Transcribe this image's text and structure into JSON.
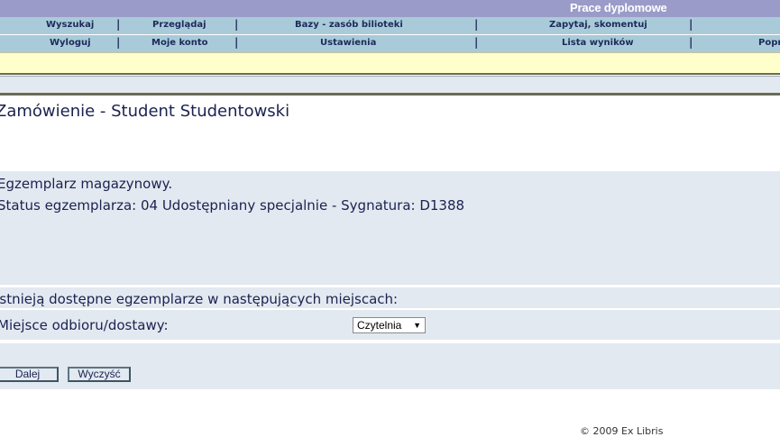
{
  "header": {
    "title": "Prace dyplomowe"
  },
  "nav": {
    "row1": [
      "Wyszukaj",
      "Przeglądaj",
      "Bazy - zasób bilioteki",
      "Zapytaj, skomentuj"
    ],
    "row2": [
      "Wyloguj",
      "Moje konto",
      "Ustawienia",
      "Lista wyników",
      "Popr"
    ],
    "separator": "|"
  },
  "page": {
    "title": "Zamówienie - Student Studentowski",
    "item_type": "Egzemplarz magazynowy.",
    "item_status": "Status egzemplarza: 04 Udostępniany specjalnie - Sygnatura: D1388",
    "availability_note": "Istnieją dostępne egzemplarze w następujących miejscach:",
    "pickup_label": "Miejsce odbioru/dostawy:",
    "pickup_selected": "Czytelnia"
  },
  "buttons": {
    "next": "Dalej",
    "clear": "Wyczyść"
  },
  "footer": {
    "copyright": "© 2009 Ex Libris"
  },
  "icons": {
    "dropdown": "chevron-down-icon"
  },
  "colors": {
    "header": "#9b9bc9",
    "nav": "#a9cbd9",
    "notice": "#ffffcc",
    "panel": "#e3e9f0",
    "text": "#1a2250"
  }
}
